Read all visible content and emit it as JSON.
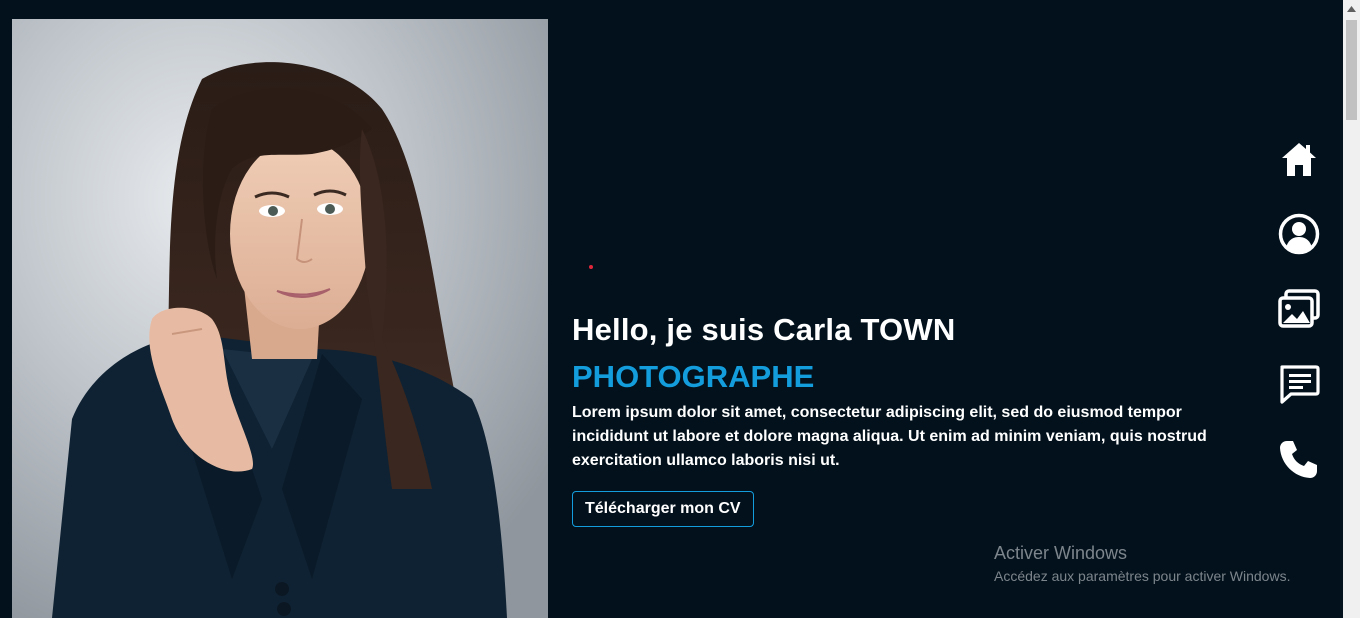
{
  "hero": {
    "greeting": "Hello, je suis Carla TOWN",
    "role": "PHOTOGRAPHE",
    "intro": "Lorem ipsum dolor sit amet, consectetur adipiscing elit, sed do eiusmod tempor incididunt ut labore et dolore magna aliqua. Ut enim ad minim veniam, quis nostrud exercitation ullamco laboris nisi ut.",
    "cv_button": "Télécharger mon CV"
  },
  "nav": {
    "items": [
      {
        "icon": "home-icon"
      },
      {
        "icon": "user-circle-icon"
      },
      {
        "icon": "gallery-icon"
      },
      {
        "icon": "message-icon"
      },
      {
        "icon": "phone-icon"
      }
    ]
  },
  "watermark": {
    "title": "Activer Windows",
    "subtitle": "Accédez aux paramètres pour activer Windows."
  },
  "colors": {
    "background": "#02111c",
    "accent": "#149ddd",
    "dot": "#e0263a"
  }
}
